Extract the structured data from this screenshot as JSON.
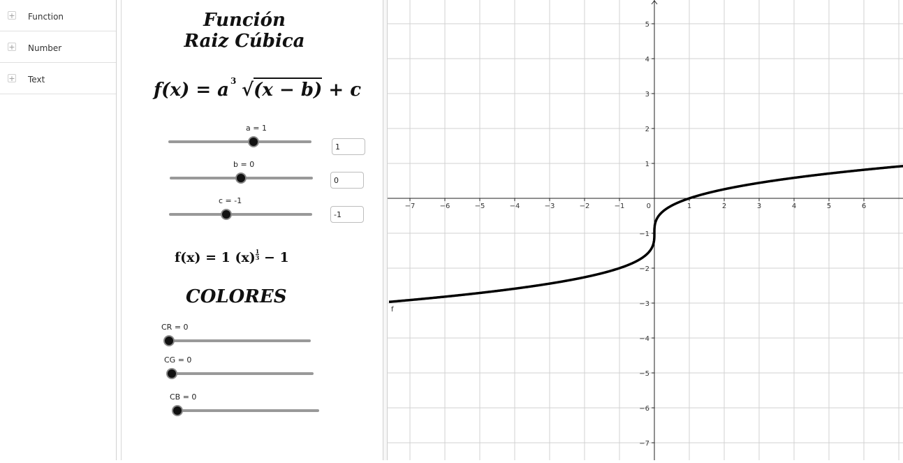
{
  "algebra": {
    "items": [
      {
        "label": "Function"
      },
      {
        "label": "Number"
      },
      {
        "label": "Text"
      }
    ],
    "plus_glyph": "+"
  },
  "panel": {
    "title_line1": "Función",
    "title_line2": "Raiz Cúbica",
    "formula": {
      "lhs": "f(x) = a",
      "root_index": "3",
      "radicand": "(x − b)",
      "rhs": " + c"
    },
    "sliders": [
      {
        "caption": "a = 1",
        "input_value": "1",
        "value": 1,
        "min": -5,
        "max": 5
      },
      {
        "caption": "b = 0",
        "input_value": "0",
        "value": 0,
        "min": -5,
        "max": 5
      },
      {
        "caption": "c = -1",
        "input_value": "-1",
        "value": -1,
        "min": -5,
        "max": 5
      }
    ],
    "result": {
      "prefix": "f(x) = 1 (x)",
      "exp_num": "1",
      "exp_den": "3",
      "suffix": " − 1"
    },
    "colors_title": "COLORES",
    "color_sliders": [
      {
        "caption": "CR = 0",
        "value": 0,
        "min": 0,
        "max": 1
      },
      {
        "caption": "CG = 0",
        "value": 0,
        "min": 0,
        "max": 1
      },
      {
        "caption": "CB = 0",
        "value": 0,
        "min": 0,
        "max": 1
      }
    ]
  },
  "graph": {
    "function_label": "f",
    "x_ticks": [
      "-7",
      "-6",
      "-5",
      "-4",
      "-3",
      "-2",
      "-1",
      "0",
      "1",
      "2",
      "3",
      "4",
      "5",
      "6"
    ],
    "y_ticks": [
      "5",
      "4",
      "3",
      "2",
      "1",
      "-1",
      "-2",
      "-3",
      "-4",
      "-5",
      "-6",
      "-7"
    ],
    "x_range": [
      -7.6,
      7.1
    ],
    "y_range": [
      -7.4,
      5.7
    ],
    "curve_color": "#000000",
    "grid_color": "#d2d2d2",
    "function": {
      "a": 1,
      "b": 0,
      "c": -1
    }
  }
}
